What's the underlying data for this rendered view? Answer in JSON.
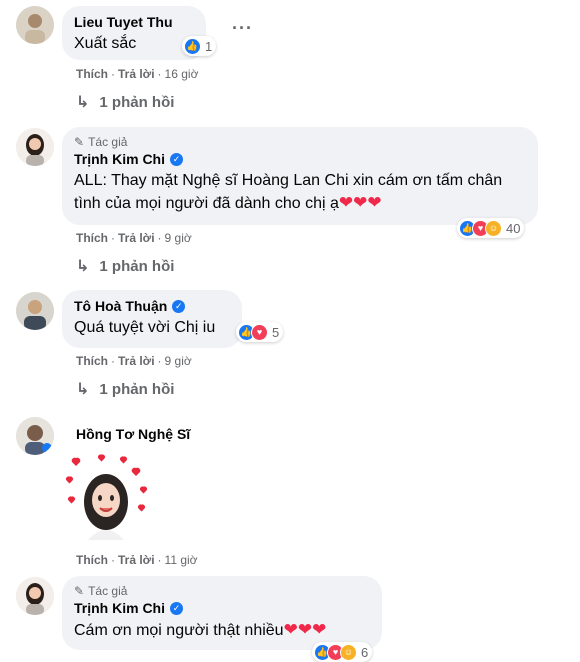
{
  "comments": [
    {
      "name": "Lieu Tuyet Thu",
      "text": "Xuất sắc",
      "like_label": "Thích",
      "reply_label": "Trả lời",
      "time": "16 giờ",
      "reaction_count": "1",
      "replies": "1 phản hồi"
    },
    {
      "author_tag": "Tác giả",
      "name": "Trịnh Kim Chi",
      "text": "ALL: Thay mặt Nghệ sĩ Hoàng Lan Chi xin cám ơn tấm chân tình của mọi người đã dành cho chị ạ",
      "like_label": "Thích",
      "reply_label": "Trả lời",
      "time": "9 giờ",
      "reaction_count": "40",
      "replies": "1 phản hồi"
    },
    {
      "name": "Tô Hoà Thuận",
      "text": "Quá tuyệt vời Chị iu",
      "like_label": "Thích",
      "reply_label": "Trả lời",
      "time": "9 giờ",
      "reaction_count": "5",
      "replies": "1 phản hồi"
    },
    {
      "name": "Hồng Tơ Nghệ Sĩ",
      "like_label": "Thích",
      "reply_label": "Trả lời",
      "time": "11 giờ"
    },
    {
      "author_tag": "Tác giả",
      "name": "Trịnh Kim Chi",
      "text": "Cám ơn mọi người thật nhiều",
      "reaction_count": "6"
    }
  ],
  "more_label": "···",
  "hearts": "❤❤❤",
  "colors": {
    "like_blue": "#1877f2",
    "bubble_bg": "#f0f2f5",
    "meta_gray": "#65676b",
    "heart_red": "#f02849"
  }
}
